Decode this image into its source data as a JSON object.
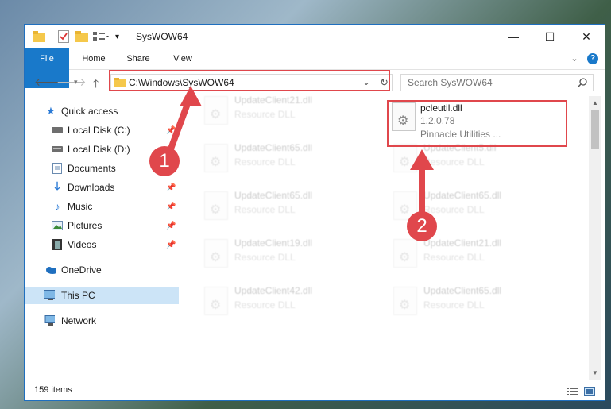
{
  "window": {
    "title": "SysWOW64",
    "controls": {
      "minimize": "—",
      "maximize": "☐",
      "close": "✕"
    }
  },
  "ribbon": {
    "tabs": [
      {
        "label": "File"
      },
      {
        "label": "Home"
      },
      {
        "label": "Share"
      },
      {
        "label": "View"
      }
    ],
    "expand_glyph": "⌄",
    "help_glyph": "?"
  },
  "address": {
    "path": "C:\\Windows\\SysWOW64",
    "search_placeholder": "Search SysWOW64"
  },
  "nav": {
    "items": [
      {
        "label": "Quick access",
        "icon": "star-icon"
      },
      {
        "label": "Local Disk (C:)",
        "icon": "drive-icon"
      },
      {
        "label": "Local Disk (D:)",
        "icon": "drive-icon"
      },
      {
        "label": "Documents",
        "icon": "documents-icon"
      },
      {
        "label": "Downloads",
        "icon": "download-icon"
      },
      {
        "label": "Music",
        "icon": "music-icon"
      },
      {
        "label": "Pictures",
        "icon": "pictures-icon"
      },
      {
        "label": "Videos",
        "icon": "videos-icon"
      },
      {
        "label": "OneDrive",
        "icon": "cloud-icon"
      },
      {
        "label": "This PC",
        "icon": "computer-icon",
        "selected": true
      },
      {
        "label": "Network",
        "icon": "network-icon"
      }
    ]
  },
  "files": {
    "highlighted": {
      "name": "pcleutil.dll",
      "version": "1.2.0.78",
      "company": "Pinnacle Utilities ..."
    },
    "background": [
      {
        "name": "UpdateClient21.dll",
        "type": "Resource DLL"
      },
      {
        "name": "UpdateClient65.dll",
        "type": "Resource DLL"
      },
      {
        "name": "UpdateClient5.dll",
        "type": "Resource DLL"
      },
      {
        "name": "UpdateClient65.dll",
        "type": "Resource DLL"
      },
      {
        "name": "UpdateClient65.dll",
        "type": "Resource DLL"
      },
      {
        "name": "UpdateClient19.dll",
        "type": "Resource DLL"
      },
      {
        "name": "UpdateClient21.dll",
        "type": "Resource DLL"
      },
      {
        "name": "UpdateClient42.dll",
        "type": "Resource DLL"
      },
      {
        "name": "UpdateClient65.dll",
        "type": "Resource DLL"
      }
    ]
  },
  "status": {
    "item_count": "159 items"
  },
  "annotations": {
    "step1": "1",
    "step2": "2",
    "color": "#e0474c"
  }
}
